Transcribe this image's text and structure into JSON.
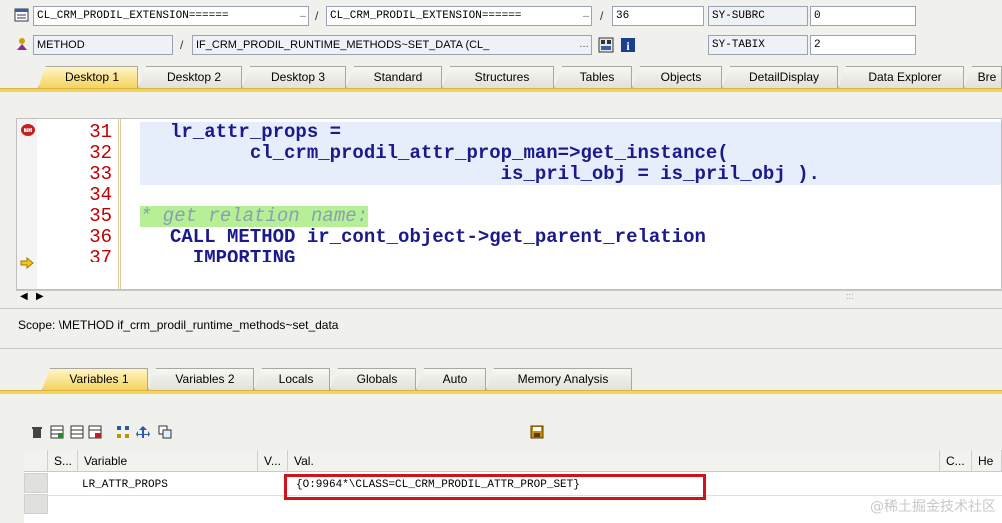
{
  "header": {
    "program_field": "CL_CRM_PRODIL_EXTENSION======",
    "include_field": "CL_CRM_PRODIL_EXTENSION======",
    "line_field": "36",
    "event_type": "METHOD",
    "event_name": "IF_CRM_PRODIL_RUNTIME_METHODS~SET_DATA (CL_",
    "sys1_label": "SY-SUBRC",
    "sys1_value": "0",
    "sys2_label": "SY-TABIX",
    "sys2_value": "2",
    "slash": "/"
  },
  "top_tabs": [
    "Desktop 1",
    "Desktop 2",
    "Desktop 3",
    "Standard",
    "Structures",
    "Tables",
    "Objects",
    "DetailDisplay",
    "Data Explorer",
    "Bre"
  ],
  "code": {
    "line_numbers": [
      "31",
      "32",
      "33",
      "34",
      "35",
      "36",
      "37"
    ],
    "lines": [
      "lr_attr_props =",
      "       cl_crm_prodil_attr_prop_man=>get_instance(",
      "                             is_pril_obj = is_pril_obj ).",
      "",
      "* get relation name:",
      "CALL METHOD ir_cont_object->get_parent_relation",
      "  IMPORTING"
    ]
  },
  "scope": "Scope: \\METHOD if_crm_prodil_runtime_methods~set_data",
  "bottom_tabs": [
    "Variables 1",
    "Variables 2",
    "Locals",
    "Globals",
    "Auto",
    "Memory Analysis"
  ],
  "table": {
    "headers": [
      "S...",
      "Variable",
      "V...",
      "Val.",
      "C...",
      "He"
    ],
    "rows": [
      {
        "variable": "LR_ATTR_PROPS",
        "value": "{O:9964*\\CLASS=CL_CRM_PRODIL_ATTR_PROP_SET}"
      }
    ]
  },
  "watermark": "@稀土掘金技术社区",
  "colors": {
    "active_tab": "#f5d35e",
    "line_number": "#c00000",
    "highlight_box": "#d0121b"
  }
}
